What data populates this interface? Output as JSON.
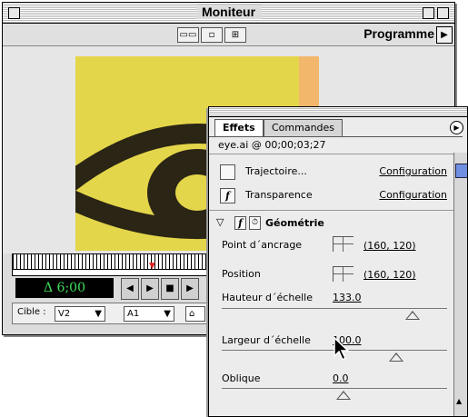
{
  "monitor": {
    "title": "Moniteur",
    "program_label": "Programme",
    "timecode": "Δ 6;00",
    "target_label": "Cible :",
    "video_track": "V2",
    "audio_track": "A1"
  },
  "effects": {
    "tabs": [
      "Effets",
      "Commandes"
    ],
    "clip_info": "eye.ai @ 00;00;03;27",
    "rows": [
      {
        "label": "Trajectoire...",
        "link": "Configuration",
        "checked_symbol": ""
      },
      {
        "label": "Transparence",
        "link": "Configuration",
        "checked_symbol": "f"
      }
    ],
    "geometry": {
      "title": "Géométrie",
      "func_symbol": "f",
      "params": [
        {
          "label": "Point d´ancrage",
          "value": "(160, 120)"
        },
        {
          "label": "Position",
          "value": "(160, 120)"
        },
        {
          "label": "Hauteur d´échelle",
          "value": "133.0"
        },
        {
          "label": "Largeur d´échelle",
          "value": "100.0"
        },
        {
          "label": "Oblique",
          "value": "0.0"
        }
      ]
    }
  }
}
